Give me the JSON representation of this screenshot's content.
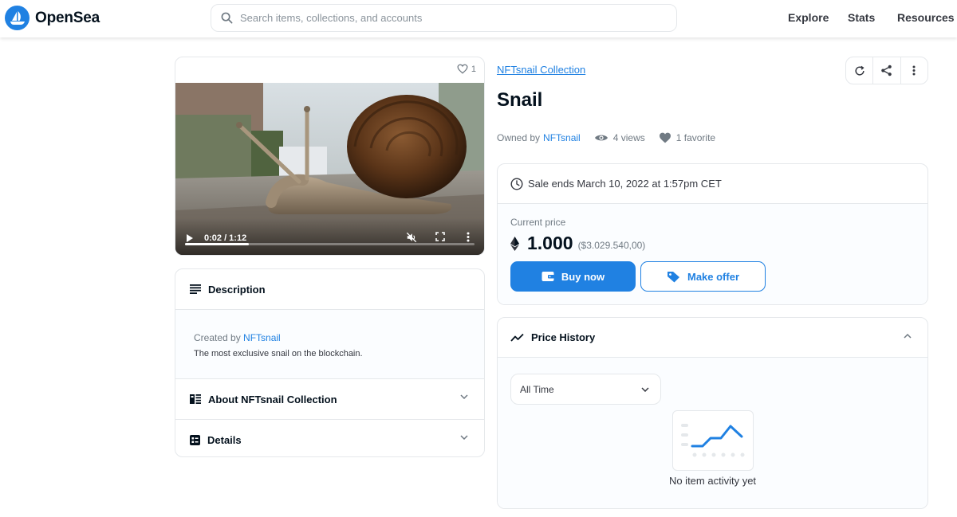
{
  "header": {
    "logo_text": "OpenSea",
    "search_placeholder": "Search items, collections, and accounts",
    "nav": [
      "Explore",
      "Stats",
      "Resources"
    ]
  },
  "media": {
    "favorite_count": "1",
    "video_time": "0:02 / 1:12",
    "progress_fraction": 0.22
  },
  "description": {
    "title": "Description",
    "created_by_label": "Created by",
    "creator": "NFTsnail",
    "text": "The most exclusive snail on the blockchain."
  },
  "sections": {
    "about": "About NFTsnail Collection",
    "details": "Details"
  },
  "item": {
    "collection": "NFTsnail Collection",
    "title": "Snail",
    "owned_by_label": "Owned by",
    "owner": "NFTsnail",
    "views": "4 views",
    "favorites": "1 favorite"
  },
  "sale": {
    "ends": "Sale ends March 10, 2022 at 1:57pm CET",
    "current_price_label": "Current price",
    "price": "1.000",
    "price_usd": "($3.029.540,00)",
    "buy_label": "Buy now",
    "offer_label": "Make offer"
  },
  "history": {
    "title": "Price History",
    "range": "All Time",
    "empty": "No item activity yet"
  },
  "colors": {
    "accent": "#2081e2",
    "text": "#04111d",
    "muted": "#707a83",
    "border": "#e5e8eb"
  }
}
